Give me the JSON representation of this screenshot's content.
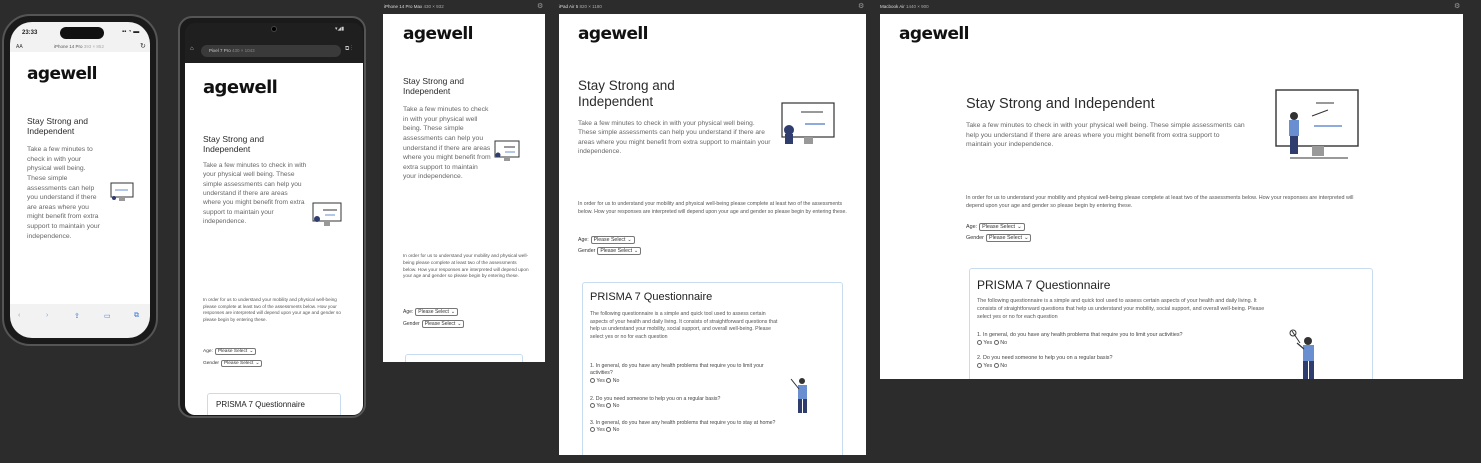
{
  "brand": "agewell",
  "heading": "Stay Strong and Independent",
  "intro": "Take a few minutes to check in with your physical well being. These simple assessments can help you understand if there are areas where you might benefit from extra support to maintain your independence.",
  "instructions": "In order for us to understand your mobility and physical well-being please complete at least two of the assessments below. How your responses are interpreted will depend upon your age and gender so please begin by entering these.",
  "age_label": "Age:",
  "gender_label": "Gender",
  "select_placeholder": "Please Select",
  "questionnaire": {
    "title": "PRISMA 7 Questionnaire",
    "description": "The following questionnaire is a simple and quick tool used to assess certain aspects of your health and daily living. It consists of straightforward questions that help us understand your mobility, social support, and overall well-being. Please select yes or no for each question",
    "q1": "1. In general, do you have any health problems that require you to limit your activities?",
    "q2": "2. Do you need someone to help you on a regular basis?",
    "q3": "3. In general, do you have any health problems that require you to stay at home?",
    "yes": "Yes",
    "no": "No"
  },
  "frames": {
    "iphone14pro": {
      "name": "iPhone 14 Pro",
      "size": "393 × 852",
      "time": "23:33"
    },
    "pixel7pro": {
      "name": "Pixel 7 Pro",
      "size": "430 × 1043"
    },
    "iphone14promax": {
      "name": "iPhone 14 Pro Max",
      "size": "430 × 932"
    },
    "ipadair5": {
      "name": "iPad Air 5",
      "size": "820 × 1180"
    },
    "macbookair": {
      "name": "Macbook Air",
      "size": "1440 × 900"
    }
  },
  "safari_toolbar": {
    "text_size": "AA"
  },
  "icons": [
    "gear-icon",
    "reload-icon",
    "back-icon",
    "forward-icon",
    "share-icon",
    "bookmarks-icon",
    "tabs-icon",
    "home-icon",
    "chevron-down-icon"
  ]
}
